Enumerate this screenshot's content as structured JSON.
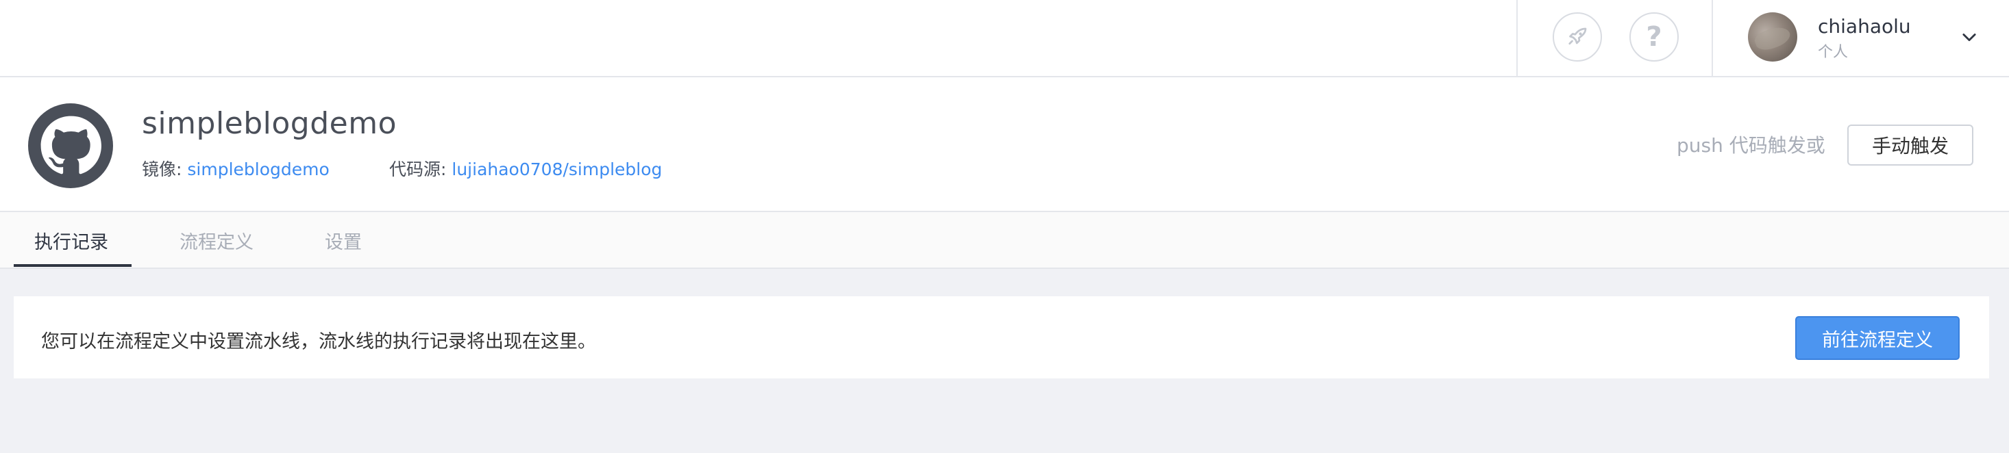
{
  "topbar": {
    "rocket_icon": "rocket-icon",
    "help_icon": "question-icon",
    "help_glyph": "?",
    "user": {
      "name": "chiahaolu",
      "sub": "个人"
    }
  },
  "repo": {
    "title": "simpleblogdemo",
    "image_label": "镜像:",
    "image_value": "simpleblogdemo",
    "source_label": "代码源:",
    "source_value": "lujiahao0708/simpleblog",
    "push_hint": "push 代码触发或",
    "manual_trigger": "手动触发"
  },
  "tabs": [
    {
      "label": "执行记录",
      "active": true
    },
    {
      "label": "流程定义",
      "active": false
    },
    {
      "label": "设置",
      "active": false
    }
  ],
  "notice": {
    "text": "您可以在流程定义中设置流水线，流水线的执行记录将出现在这里。",
    "button": "前往流程定义"
  },
  "colors": {
    "accent": "#4c95f0",
    "link": "#3d8bf0",
    "background": "#f0f1f5"
  }
}
